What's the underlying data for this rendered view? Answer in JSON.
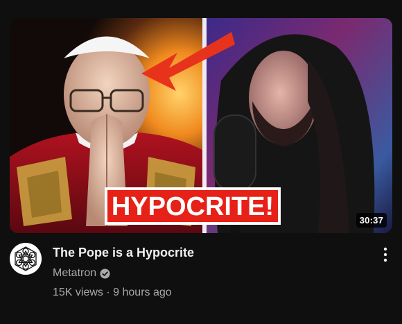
{
  "video": {
    "title": "The Pope is a Hypocrite",
    "duration": "30:37",
    "thumbnail_text": "HYPOCRITE!",
    "channel": "Metatron",
    "views": "15K views",
    "separator": "·",
    "age": "9 hours ago"
  },
  "icons": {
    "verified": "verified-check-icon",
    "more": "more-vertical-icon",
    "avatar": "metatron-cube-icon"
  },
  "colors": {
    "background": "#0f0f0f",
    "title": "#f1f1f1",
    "secondary_text": "#aaaaaa",
    "thumbnail_banner": "#e62117",
    "arrow": "#e8331c"
  }
}
